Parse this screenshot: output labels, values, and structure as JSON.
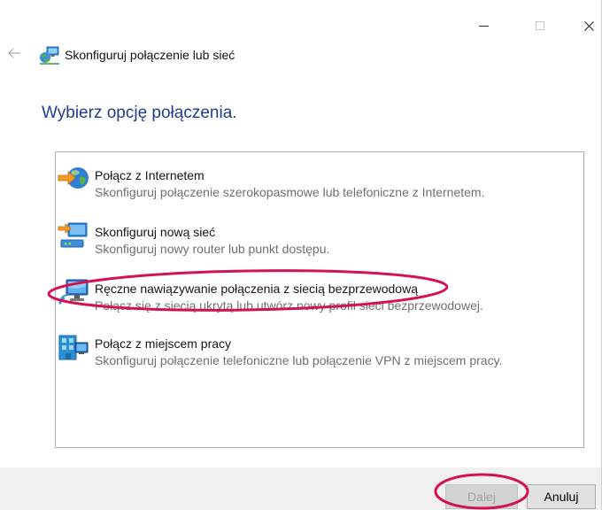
{
  "window": {
    "title": "Skonfiguruj połączenie lub sieć",
    "title_icon": "network-icon",
    "back_icon": "back-arrow-icon",
    "controls": [
      "minimize-icon",
      "maximize-icon",
      "close-icon"
    ]
  },
  "main": {
    "heading": "Wybierz opcję połączenia.",
    "options": [
      {
        "icon": "internet-globe-icon",
        "title": "Połącz z Internetem",
        "description": "Skonfiguruj połączenie szerokopasmowe lub telefoniczne z Internetem."
      },
      {
        "icon": "router-icon",
        "title": "Skonfiguruj nową sieć",
        "description": "Skonfiguruj nowy router lub punkt dostępu."
      },
      {
        "icon": "wireless-network-icon",
        "title": "Ręczne nawiązywanie połączenia z siecią bezprzewodową",
        "description": "Połącz się z siecią ukrytą lub utwórz nowy profil sieci bezprzewodowej."
      },
      {
        "icon": "workplace-icon",
        "title": "Połącz z miejscem pracy",
        "description": "Skonfiguruj połączenie telefoniczne lub połączenie VPN z miejscem pracy."
      }
    ]
  },
  "footer": {
    "next_label": "Dalej",
    "next_enabled": false,
    "cancel_label": "Anuluj"
  },
  "colors": {
    "heading": "#1f3d8a",
    "annotation": "#d3134f",
    "footer_background": "#f0f0f0"
  }
}
